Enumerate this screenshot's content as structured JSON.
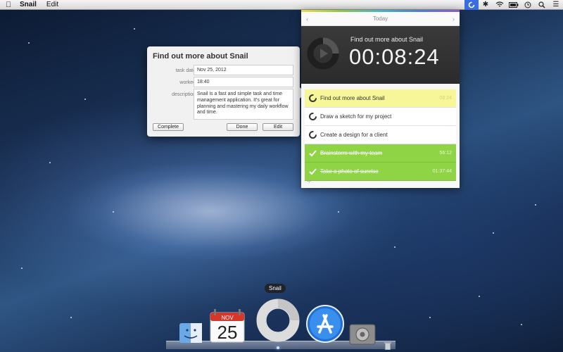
{
  "menubar": {
    "apple_icon": "apple-icon",
    "app_name": "Snail",
    "menus": [
      "Edit"
    ],
    "status_icons": [
      "snail-status-icon",
      "bluetooth-icon",
      "wifi-icon",
      "battery-icon",
      "time-machine-icon",
      "search-icon",
      "list-icon"
    ]
  },
  "popover": {
    "title": "Find out more about Snail",
    "task_date_label": "task date",
    "task_date_value": "Nov 25, 2012",
    "worked_label": "worked",
    "worked_value": "18:40",
    "description_label": "description",
    "description_value": "Snail is a fast and simple task and time management application. It's great for planning and mastering my daily workflow and time.",
    "complete_button": "Complete",
    "done_button": "Done",
    "edit_button": "Edit"
  },
  "snail_window": {
    "nav_prev": "‹",
    "nav_title": "Today",
    "nav_next": "›",
    "current_task": "Find out more about Snail",
    "timer": "00:08:24",
    "tasks": [
      {
        "label": "Find out more about Snail",
        "time": "08:24",
        "state": "active"
      },
      {
        "label": "Draw a sketch for my project",
        "time": "",
        "state": "pending"
      },
      {
        "label": "Create a design for a client",
        "time": "",
        "state": "pending"
      },
      {
        "label": "Brainstorm with my team",
        "time": "56:12",
        "state": "done"
      },
      {
        "label": "Take a photo of sunrise",
        "time": "01:37:44",
        "state": "done"
      }
    ],
    "add_button": "+"
  },
  "dock": {
    "tooltip": "Snail",
    "items": [
      "finder-icon",
      "calendar-icon",
      "snail-app-icon",
      "app-store-icon",
      "system-preferences-icon",
      "trash-icon"
    ],
    "calendar_month": "NOV",
    "calendar_day": "25"
  },
  "colors": {
    "active_task": "#f7f79a",
    "done_task": "#8fd444",
    "timer_bg": "#333333",
    "menubar_highlight": "#3a6ee0"
  }
}
